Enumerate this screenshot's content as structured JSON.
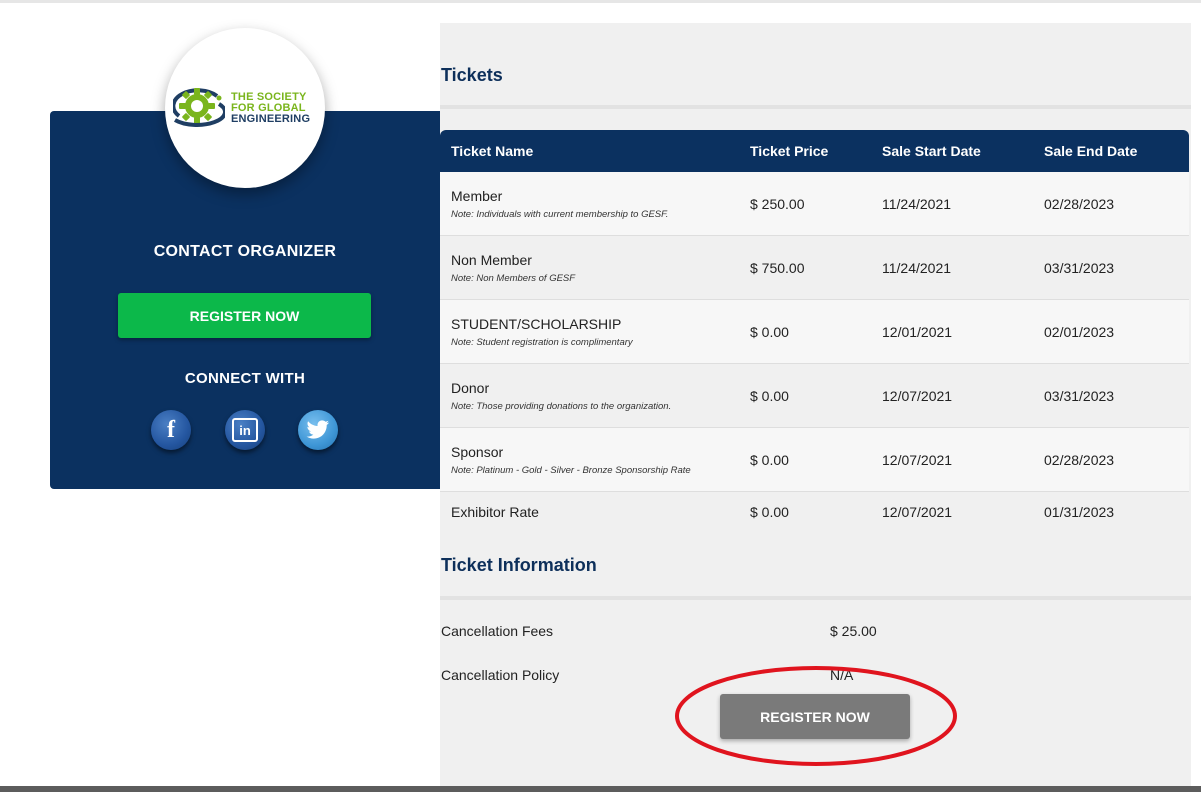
{
  "organizer": {
    "logo": {
      "line1": "THE SOCIETY",
      "line2": "FOR GLOBAL",
      "line3": "ENGINEERING"
    },
    "contact_title": "CONTACT ORGANIZER",
    "register_label": "REGISTER NOW",
    "connect_title": "CONNECT WITH",
    "social": [
      {
        "name": "facebook-icon",
        "glyph": "f"
      },
      {
        "name": "linkedin-icon",
        "glyph": "in"
      },
      {
        "name": "twitter-icon",
        "glyph": "bird"
      }
    ]
  },
  "tickets": {
    "title": "Tickets",
    "columns": [
      "Ticket Name",
      "Ticket Price",
      "Sale Start Date",
      "Sale End Date"
    ],
    "rows": [
      {
        "name": "Member",
        "note": "Note: Individuals with current membership to GESF.",
        "price": "$ 250.00",
        "start": "11/24/2021",
        "end": "02/28/2023"
      },
      {
        "name": "Non Member",
        "note": "Note: Non Members of GESF",
        "price": "$ 750.00",
        "start": "11/24/2021",
        "end": "03/31/2023"
      },
      {
        "name": "STUDENT/SCHOLARSHIP",
        "note": "Note: Student registration is complimentary",
        "price": "$ 0.00",
        "start": "12/01/2021",
        "end": "02/01/2023"
      },
      {
        "name": "Donor",
        "note": "Note: Those providing donations to the organization.",
        "price": "$ 0.00",
        "start": "12/07/2021",
        "end": "03/31/2023"
      },
      {
        "name": "Sponsor",
        "note": "Note: Platinum - Gold - Silver - Bronze Sponsorship Rate",
        "price": "$ 0.00",
        "start": "12/07/2021",
        "end": "02/28/2023"
      },
      {
        "name": "Exhibitor Rate",
        "note": "",
        "price": "$ 0.00",
        "start": "12/07/2021",
        "end": "01/31/2023"
      }
    ]
  },
  "ticket_info": {
    "title": "Ticket Information",
    "cancellation_fees_label": "Cancellation Fees",
    "cancellation_fees_value": "$ 25.00",
    "cancellation_policy_label": "Cancellation Policy",
    "cancellation_policy_value": "N/A",
    "register_label": "REGISTER NOW"
  },
  "colors": {
    "navy": "#0b3160",
    "green_button": "#0cb84a",
    "gray_button": "#7a7a7a",
    "logo_green": "#7ab51d",
    "highlight_red": "#e0141e"
  }
}
